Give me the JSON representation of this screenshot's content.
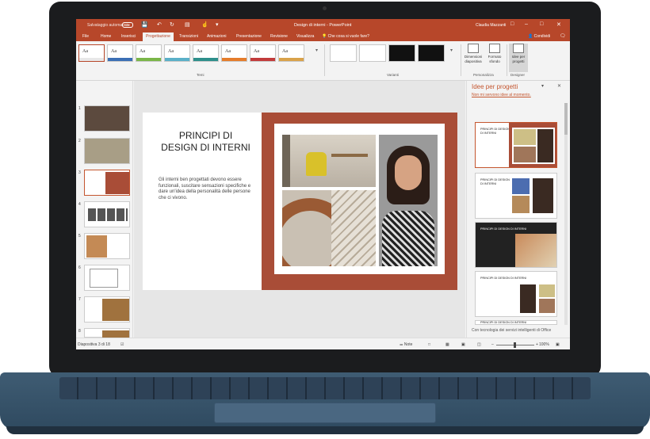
{
  "titlebar": {
    "autosave": "Salvataggio automatico",
    "autosave_toggle": "Off",
    "doc_title": "Design di interni - PowerPoint",
    "user": "Claudia Mazzanti",
    "icons": [
      "save-icon",
      "undo-icon",
      "redo-icon",
      "start-presentation-icon",
      "touch-mode-icon",
      "customize-icon"
    ]
  },
  "tabs": [
    "File",
    "Home",
    "Inserisci",
    "Progettazione",
    "Transizioni",
    "Animazioni",
    "Presentazione",
    "Revisione",
    "Visualizza"
  ],
  "active_tab": "Progettazione",
  "search_text": "Che cosa si vuole fare?",
  "share_label": "Condividi",
  "ribbon": {
    "themes": [
      {
        "label": "Aa",
        "bar": "#e8e8e8"
      },
      {
        "label": "Aa",
        "bar": "#3b6fb5"
      },
      {
        "label": "Aa",
        "bar": "#7ab648"
      },
      {
        "label": "Aa",
        "bar": "#5ab0c8"
      },
      {
        "label": "Aa",
        "bar": "#2d8f8b"
      },
      {
        "label": "Aa",
        "bar": "#e57c2b"
      },
      {
        "label": "Aa",
        "bar": "#c23b3b"
      },
      {
        "label": "Aa",
        "bar": "#d9a24a"
      }
    ],
    "temi_label": "Temi",
    "varianti_label": "Varianti",
    "variants": [
      "#ffffff",
      "#ffffff",
      "#111111",
      "#111111"
    ],
    "personalizza_label": "Personalizza",
    "designer_label": "Designer",
    "btn_dim": "Dimensioni diapositiva",
    "btn_formato": "Formato sfondo",
    "btn_idee": "Idee per progetti"
  },
  "slides": [
    "1",
    "2",
    "3",
    "4",
    "5",
    "6",
    "7",
    "8"
  ],
  "current_slide": {
    "title": "PRINCIPI DI DESIGN DI INTERNI",
    "body": "Gli interni ben progettati devono essere funzionali, suscitare sensazioni specifiche e dare un'idea della personalità delle persone che ci vivono.",
    "accent": "#a94d37"
  },
  "designer": {
    "title": "Idee per progetti",
    "subtitle": "Non mi servono idee al momento.",
    "cards": [
      "PRINCIPI DI DESIGN DI INTERNI",
      "PRINCIPI DI DESIGN DI INTERNI",
      "PRINCIPI DI DESIGN DI INTERNI",
      "PRINCIPI DI DESIGN DI INTERNI",
      "PRINCIPI DI DESIGN DI INTERNI"
    ],
    "footer": "Con tecnologia dei servizi intelligenti di Office"
  },
  "status": {
    "slide_info": "Diapositiva 3 di 18",
    "notes": "Note",
    "zoom": "100%"
  }
}
